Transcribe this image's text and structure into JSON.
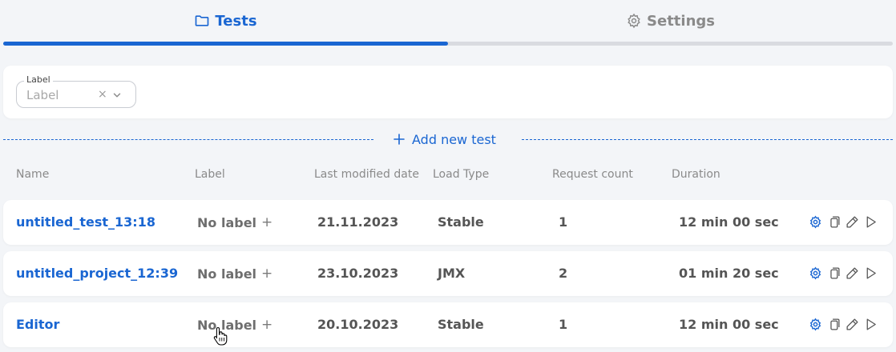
{
  "tabs": [
    {
      "label": "Tests",
      "icon": "folder-icon",
      "active": true
    },
    {
      "label": "Settings",
      "icon": "gear-icon",
      "active": false
    }
  ],
  "filter": {
    "legend": "Label",
    "placeholder": "Label",
    "clear": "×"
  },
  "add_new_test": {
    "label": "Add new test",
    "icon": "plus-icon"
  },
  "columns": {
    "name": "Name",
    "label": "Label",
    "date": "Last modified date",
    "load": "Load Type",
    "requests": "Request count",
    "duration": "Duration"
  },
  "tests": [
    {
      "name": "untitled_test_13:18",
      "label": "No label",
      "date": "21.11.2023",
      "load_type": "Stable",
      "requests": "1",
      "duration": "12 min 00 sec"
    },
    {
      "name": "untitled_project_12:39",
      "label": "No label",
      "date": "23.10.2023",
      "load_type": "JMX",
      "requests": "2",
      "duration": "01 min 20 sec"
    },
    {
      "name": "Editor",
      "label": "No label",
      "date": "20.10.2023",
      "load_type": "Stable",
      "requests": "1",
      "duration": "12 min 00 sec"
    }
  ],
  "colors": {
    "accent": "#1a66d2",
    "background": "#f3f5f8",
    "card": "#ffffff",
    "muted": "#8a8a8a"
  }
}
